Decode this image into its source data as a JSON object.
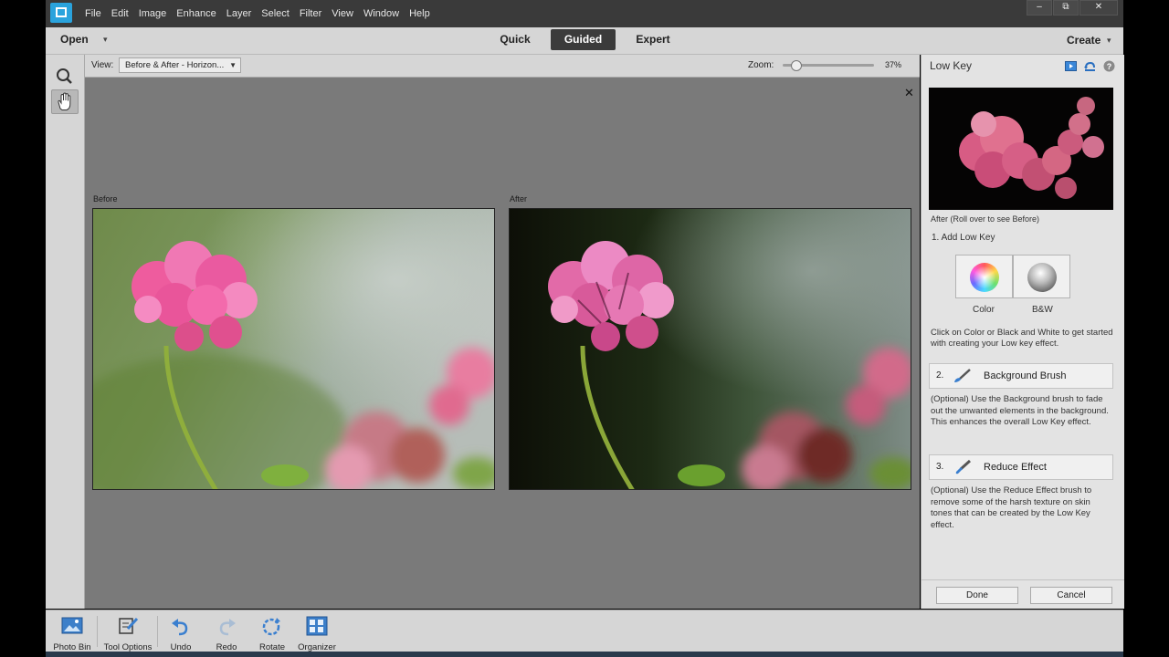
{
  "menubar": {
    "items": [
      "File",
      "Edit",
      "Image",
      "Enhance",
      "Layer",
      "Select",
      "Filter",
      "View",
      "Window",
      "Help"
    ]
  },
  "window_controls": [
    "–",
    "⧉",
    "✕"
  ],
  "modebar": {
    "open_label": "Open",
    "tabs": [
      {
        "label": "Quick",
        "active": false
      },
      {
        "label": "Guided",
        "active": true
      },
      {
        "label": "Expert",
        "active": false
      }
    ],
    "create_label": "Create"
  },
  "viewbar": {
    "view_label": "View:",
    "view_value": "Before & After - Horizon...",
    "zoom_label": "Zoom:",
    "zoom_value": "37%",
    "zoom_level": 0.1
  },
  "canvas": {
    "close_glyph": "✕",
    "before_label": "Before",
    "after_label": "After"
  },
  "panel": {
    "title": "Low Key",
    "preview_caption": "After (Roll over to see Before)",
    "step1": {
      "label": "1. Add Low Key",
      "options": [
        {
          "label": "Color"
        },
        {
          "label": "B&W"
        }
      ],
      "description": "Click on Color or Black and White to get started with creating your Low key effect."
    },
    "step2": {
      "number": "2.",
      "label": "Background Brush",
      "description": "(Optional) Use the Background brush to fade out the unwanted elements in the background. This enhances the overall Low Key effect."
    },
    "step3": {
      "number": "3.",
      "label": "Reduce Effect",
      "description": "(Optional) Use the Reduce Effect brush to remove some of the harsh texture on skin tones that can be created by the Low Key effect."
    },
    "done_label": "Done",
    "cancel_label": "Cancel"
  },
  "bottombar": {
    "items": [
      {
        "label": "Photo Bin",
        "icon": "photo-bin-icon"
      },
      {
        "label": "Tool Options",
        "icon": "tool-options-icon"
      },
      {
        "label": "Undo",
        "icon": "undo-icon"
      },
      {
        "label": "Redo",
        "icon": "redo-icon"
      },
      {
        "label": "Rotate",
        "icon": "rotate-icon"
      },
      {
        "label": "Organizer",
        "icon": "organizer-icon"
      }
    ]
  },
  "colors": {
    "active_tab": "#3b3b3b",
    "accent_blue": "#2aa3dd",
    "canvas_bg": "#7a7a7a"
  }
}
